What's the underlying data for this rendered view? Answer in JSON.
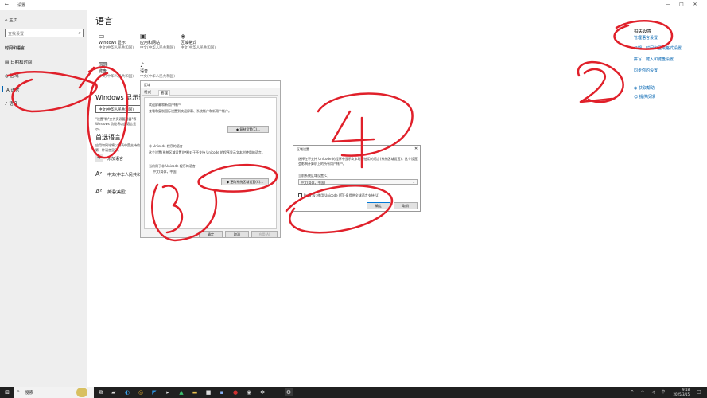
{
  "window": {
    "title": "设置",
    "controls": [
      "—",
      "□",
      "✕"
    ]
  },
  "sidebar": {
    "home": "主页",
    "search_placeholder": "查找设置",
    "section": "时间和语言",
    "items": [
      {
        "label": "日期和时间",
        "icon": "calendar-icon"
      },
      {
        "label": "区域",
        "icon": "globe-icon"
      },
      {
        "label": "语言",
        "icon": "language-icon"
      },
      {
        "label": "语音",
        "icon": "microphone-icon"
      }
    ]
  },
  "main": {
    "title": "语言",
    "tiles": [
      {
        "label": "Windows 显示",
        "sub": "中文(中华人民共和国)",
        "icon": "monitor-icon"
      },
      {
        "label": "应用和网站",
        "sub": "中文(中华人民共和国)",
        "icon": "app-window-icon"
      },
      {
        "label": "区域格式",
        "sub": "中文(中华人民共和国)",
        "icon": "region-format-icon"
      },
      {
        "label": "键盘",
        "sub": "中文(中华人民共和国)",
        "icon": "keyboard-icon"
      },
      {
        "label": "语音",
        "sub": "中文(中华人民共和国)",
        "icon": "microphone-icon"
      }
    ],
    "display_lang_heading": "Windows 显示语言",
    "display_lang_value": "中文(中华人民共和国)",
    "display_lang_note": "\"设置\"和\"文件资源管理器\"等 Windows 功能将以此语言显示。",
    "preferred_heading": "首选语言",
    "preferred_note": "应用和网站将以列表中受支持的第一种语言显示。",
    "add_language": "添加语言",
    "languages": [
      {
        "name": "中文(中华人民共和国)",
        "sub": ""
      },
      {
        "name": "英语(美国)",
        "sub": ""
      }
    ]
  },
  "related": {
    "heading": "相关设置",
    "links": [
      "管理语言设置",
      "日期、时间和区域格式设置",
      "拼写、键入和键盘设置"
    ],
    "sync": "同步你的设置",
    "help": "获取帮助",
    "feedback": "提供反馈"
  },
  "region_dialog": {
    "title": "区域",
    "tabs": [
      "格式",
      "管理"
    ],
    "welcome_heading": "欢迎屏幕和新用户帐户",
    "welcome_text": "查看和复制国际设置到欢迎屏幕、系统帐户和新用户帐户。",
    "copy_btn": "复制设置(C)...",
    "unicode_heading": "非 Unicode 程序的语言",
    "unicode_text": "这个设置(系统区域设置)控制对于不支持 Unicode 的程序显示文本时使用的语言。",
    "current_label": "当前用于非 Unicode 程序的语言:",
    "current_value": "中文(简体，中国)",
    "change_btn": "更改系统区域设置(C)...",
    "ok": "确定",
    "cancel": "取消",
    "apply": "应用(A)"
  },
  "locale_dialog": {
    "title": "区域设置",
    "text": "选择在不支持 Unicode 的程序中显示文本时所使用的语言(系统区域设置)。这个设置会影响计算机上的所有用户帐户。",
    "field_label": "当前系统区域设置(C)",
    "field_value": "中文(简体，中国)",
    "beta_label": "Beta 版: 使用 Unicode UTF-8 提供全球语言支持(U)",
    "ok": "确定",
    "cancel": "取消"
  },
  "annotations": [
    "1",
    "2",
    "3",
    "4"
  ],
  "taskbar": {
    "search": "搜索",
    "time": "9:18",
    "date": "2025/3/15",
    "apps": [
      "file-explorer-icon",
      "edge-icon",
      "chrome-icon",
      "vscode-icon",
      "terminal-icon",
      "folder-icon",
      "photoshop-icon",
      "music-icon",
      "steam-icon",
      "settings-icon",
      "pinned-icon"
    ]
  },
  "colors": {
    "accent": "#0063b1",
    "annotation": "#e0202a",
    "taskbar": "#202020",
    "sidebar": "#eeeeee"
  }
}
